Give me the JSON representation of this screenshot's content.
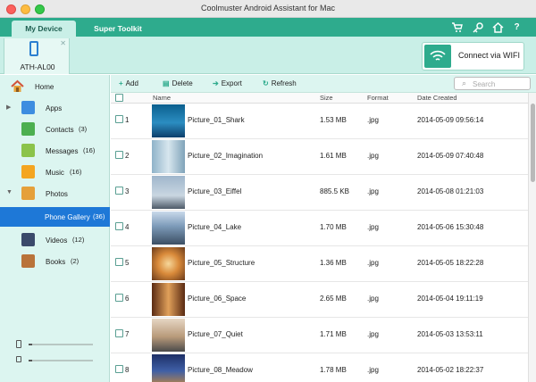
{
  "window": {
    "title": "Coolmuster Android Assistant for Mac"
  },
  "nav": {
    "tabs": [
      "My Device",
      "Super Toolkit"
    ],
    "icons": [
      "cart-icon",
      "key-icon",
      "home-icon",
      "help-icon"
    ]
  },
  "device": {
    "name": "ATH-AL00",
    "connect_label": "Connect via WIFI"
  },
  "sidebar": {
    "items": [
      {
        "label": "Home",
        "count": ""
      },
      {
        "label": "Apps",
        "count": ""
      },
      {
        "label": "Contacts",
        "count": "(3)"
      },
      {
        "label": "Messages",
        "count": "(16)"
      },
      {
        "label": "Music",
        "count": "(16)"
      },
      {
        "label": "Photos",
        "count": ""
      },
      {
        "label": "Phone Gallery",
        "count": "(36)"
      },
      {
        "label": "Videos",
        "count": "(12)"
      },
      {
        "label": "Books",
        "count": "(2)"
      }
    ],
    "selected": "Phone Gallery",
    "storage": {
      "phone_used": 0.05,
      "sd_used": 0.05
    }
  },
  "toolbar": {
    "add": "Add",
    "delete": "Delete",
    "export": "Export",
    "refresh": "Refresh",
    "search_placeholder": "Search"
  },
  "table": {
    "columns": [
      "Name",
      "Size",
      "Format",
      "Date Created"
    ],
    "rows": [
      {
        "index": "1",
        "name": "Picture_01_Shark",
        "size": "1.53 MB",
        "format": ".jpg",
        "date": "2014-05-09 09:56:14"
      },
      {
        "index": "2",
        "name": "Picture_02_Imagination",
        "size": "1.61 MB",
        "format": ".jpg",
        "date": "2014-05-09 07:40:48"
      },
      {
        "index": "3",
        "name": "Picture_03_Eiffel",
        "size": "885.5 KB",
        "format": ".jpg",
        "date": "2014-05-08 01:21:03"
      },
      {
        "index": "4",
        "name": "Picture_04_Lake",
        "size": "1.70 MB",
        "format": ".jpg",
        "date": "2014-05-06 15:30:48"
      },
      {
        "index": "5",
        "name": "Picture_05_Structure",
        "size": "1.36 MB",
        "format": ".jpg",
        "date": "2014-05-05 18:22:28"
      },
      {
        "index": "6",
        "name": "Picture_06_Space",
        "size": "2.65 MB",
        "format": ".jpg",
        "date": "2014-05-04 19:11:19"
      },
      {
        "index": "7",
        "name": "Picture_07_Quiet",
        "size": "1.71 MB",
        "format": ".jpg",
        "date": "2014-05-03 13:53:11"
      },
      {
        "index": "8",
        "name": "Picture_08_Meadow",
        "size": "1.78 MB",
        "format": ".jpg",
        "date": "2014-05-02 18:22:37"
      }
    ]
  },
  "colors": {
    "accent": "#2eab8d",
    "panel": "#dcf5f0",
    "selection": "#1e78d7"
  }
}
